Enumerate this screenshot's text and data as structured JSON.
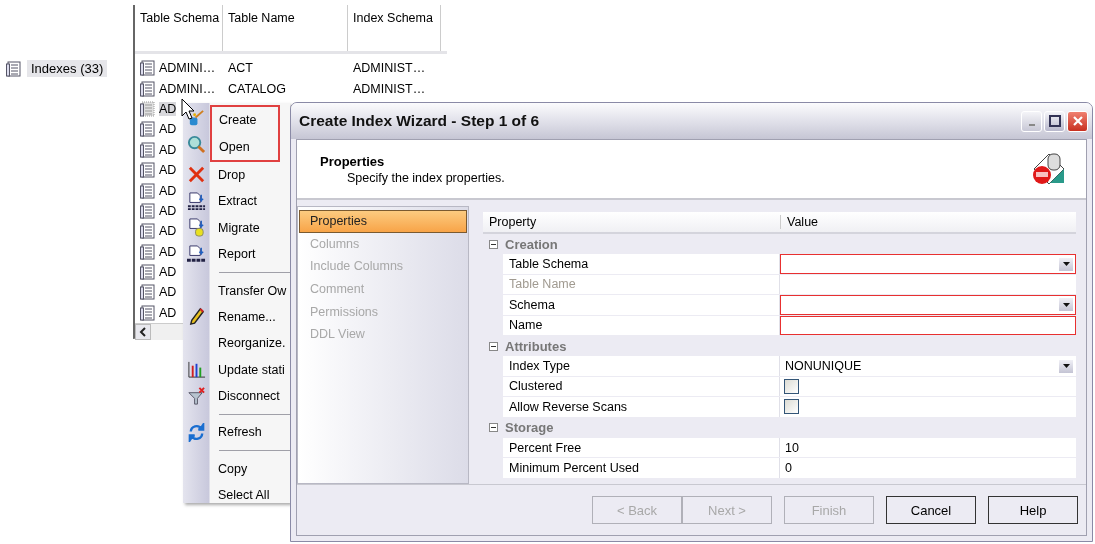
{
  "tree_item": {
    "label": "Indexes (33)"
  },
  "table": {
    "columns": [
      "Table Schema",
      "Table Name",
      "Index Schema"
    ],
    "rows": [
      {
        "cells": [
          "ADMINI…",
          "ACT",
          "ADMINIST…"
        ],
        "selected": false
      },
      {
        "cells": [
          "ADMINI…",
          "CATALOG",
          "ADMINIST…"
        ],
        "selected": false
      },
      {
        "cells": [
          "AD"
        ],
        "selected": true
      },
      {
        "cells": [
          "AD"
        ],
        "selected": false
      },
      {
        "cells": [
          "AD"
        ],
        "selected": false
      },
      {
        "cells": [
          "AD"
        ],
        "selected": false
      },
      {
        "cells": [
          "AD"
        ],
        "selected": false
      },
      {
        "cells": [
          "AD"
        ],
        "selected": false
      },
      {
        "cells": [
          "AD"
        ],
        "selected": false
      },
      {
        "cells": [
          "AD"
        ],
        "selected": false
      },
      {
        "cells": [
          "AD"
        ],
        "selected": false
      },
      {
        "cells": [
          "AD"
        ],
        "selected": false
      },
      {
        "cells": [
          "AD"
        ],
        "selected": false
      }
    ]
  },
  "context_menu": {
    "items": [
      {
        "kind": "item",
        "label": "Create",
        "annotated": true
      },
      {
        "kind": "item",
        "label": "Open",
        "annotated": true
      },
      {
        "kind": "item",
        "label": "Drop",
        "annotated": false
      },
      {
        "kind": "item",
        "label": "Extract",
        "annotated": false
      },
      {
        "kind": "item",
        "label": "Migrate",
        "annotated": false
      },
      {
        "kind": "item",
        "label": "Report",
        "annotated": false
      },
      {
        "kind": "separator"
      },
      {
        "kind": "item",
        "label": "Transfer Ow",
        "annotated": false
      },
      {
        "kind": "item",
        "label": "Rename...",
        "annotated": false
      },
      {
        "kind": "item",
        "label": "Reorganize.",
        "annotated": false
      },
      {
        "kind": "item",
        "label": "Update stati",
        "annotated": false
      },
      {
        "kind": "item",
        "label": "Disconnect",
        "annotated": false
      },
      {
        "kind": "separator"
      },
      {
        "kind": "item",
        "label": "Refresh",
        "annotated": false
      },
      {
        "kind": "separator"
      },
      {
        "kind": "item",
        "label": "Copy",
        "annotated": false
      },
      {
        "kind": "item",
        "label": "Select All",
        "annotated": false
      }
    ]
  },
  "wizard": {
    "title": "Create Index Wizard - Step 1 of 6",
    "header": {
      "title": "Properties",
      "subtitle": "Specify the index properties."
    },
    "steps": [
      {
        "label": "Properties",
        "selected": true,
        "disabled": false
      },
      {
        "label": "Columns",
        "selected": false,
        "disabled": true
      },
      {
        "label": "Include Columns",
        "selected": false,
        "disabled": true
      },
      {
        "label": "Comment",
        "selected": false,
        "disabled": true
      },
      {
        "label": "Permissions",
        "selected": false,
        "disabled": true
      },
      {
        "label": "DDL View",
        "selected": false,
        "disabled": true
      }
    ],
    "grid": {
      "columns": [
        "Property",
        "Value"
      ],
      "groups": [
        {
          "label": "Creation",
          "expanded": true,
          "rows": [
            {
              "label": "Table Schema",
              "kind": "dropdown",
              "value": "",
              "required": true,
              "disabled": false
            },
            {
              "label": "Table Name",
              "kind": "text",
              "value": "",
              "required": false,
              "disabled": true
            },
            {
              "label": "Schema",
              "kind": "dropdown",
              "value": "",
              "required": true,
              "disabled": false
            },
            {
              "label": "Name",
              "kind": "text",
              "value": "",
              "required": true,
              "disabled": false
            }
          ]
        },
        {
          "label": "Attributes",
          "expanded": true,
          "rows": [
            {
              "label": "Index Type",
              "kind": "dropdown",
              "value": "NONUNIQUE",
              "required": false,
              "disabled": false
            },
            {
              "label": "Clustered",
              "kind": "checkbox",
              "checked": false,
              "required": false,
              "disabled": false
            },
            {
              "label": "Allow Reverse Scans",
              "kind": "checkbox",
              "checked": false,
              "required": false,
              "disabled": false
            }
          ]
        },
        {
          "label": "Storage",
          "expanded": true,
          "rows": [
            {
              "label": "Percent Free",
              "kind": "text",
              "value": "10",
              "required": false,
              "disabled": false
            },
            {
              "label": "Minimum Percent Used",
              "kind": "text",
              "value": "0",
              "required": false,
              "disabled": false
            }
          ]
        }
      ]
    },
    "buttons": [
      {
        "label": "< Back",
        "disabled": true
      },
      {
        "label": "Next >",
        "disabled": true
      },
      {
        "label": "Finish",
        "disabled": true
      },
      {
        "label": "Cancel",
        "disabled": false
      },
      {
        "label": "Help",
        "disabled": false
      }
    ]
  }
}
